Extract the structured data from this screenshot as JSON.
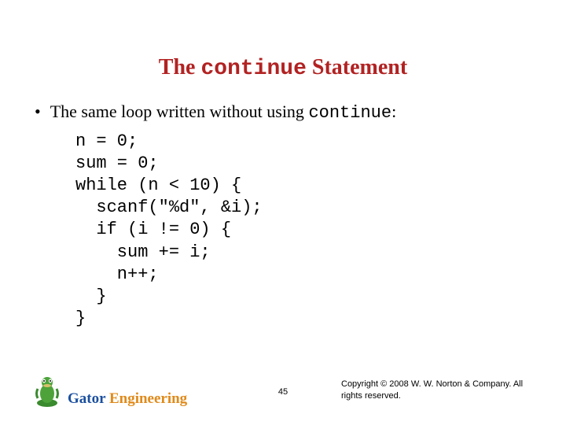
{
  "title": {
    "pre": "The ",
    "code": "continue",
    "post": " Statement"
  },
  "bullet": {
    "pre": "The same loop written without using ",
    "code": "continue",
    "post": ":"
  },
  "code": "n = 0;\nsum = 0;\nwhile (n < 10) {\n  scanf(\"%d\", &i);\n  if (i != 0) {\n    sum += i;\n    n++;\n  }\n}",
  "footer": {
    "brand1": "Gator ",
    "brand2": "Engineering",
    "page": "45",
    "copyright": "Copyright © 2008 W. W. Norton & Company.\nAll rights reserved."
  }
}
